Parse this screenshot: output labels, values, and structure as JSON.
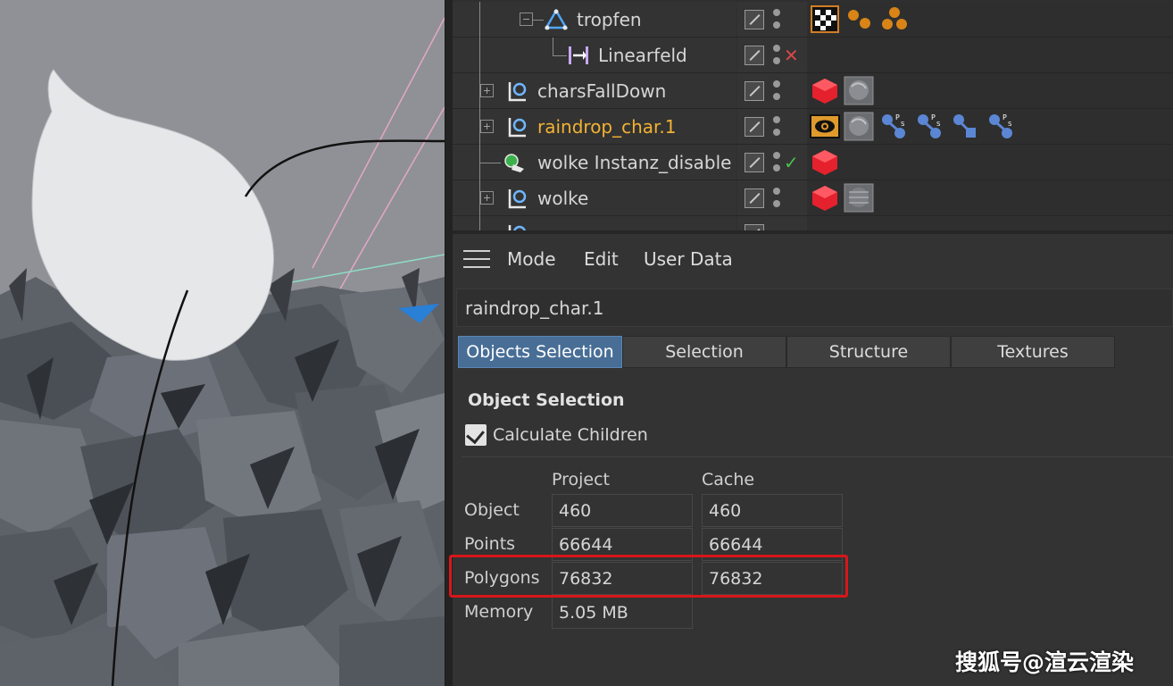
{
  "object_manager": {
    "rows": [
      {
        "label": "tropfen",
        "active": false,
        "icon": "null-emitter-icon",
        "state": "none",
        "tags": [
          "checker-material-tag",
          "orange-dots-tag",
          "orange-triangle-dots-tag"
        ]
      },
      {
        "label": "Linearfeld",
        "active": false,
        "icon": "linear-field-icon",
        "state": "disabled-x",
        "tags": []
      },
      {
        "label": "charsFallDown",
        "active": false,
        "icon": "connect-object-icon",
        "state": "none",
        "tags": [
          "red-cube-tag",
          "material-texture-tag"
        ]
      },
      {
        "label": "raindrop_char.1",
        "active": true,
        "icon": "connect-object-icon",
        "state": "none",
        "tags": [
          "display-eye-tag",
          "material-texture-tag",
          "psr-constraint-tag",
          "psr-constraint-tag",
          "ik-tag",
          "psr-constraint-tag"
        ]
      },
      {
        "label": "wolke Instanz_disable",
        "active": false,
        "icon": "instance-object-icon",
        "state": "enabled-check",
        "tags": [
          "red-cube-tag"
        ]
      },
      {
        "label": "wolke",
        "active": false,
        "icon": "connect-object-icon",
        "state": "none",
        "tags": [
          "red-cube-tag",
          "material-texture-tag"
        ]
      }
    ]
  },
  "attribute_manager": {
    "menu": [
      "Mode",
      "Edit",
      "User Data"
    ],
    "object_name": "raindrop_char.1",
    "tabs": [
      {
        "label": "Objects Selection",
        "active": true
      },
      {
        "label": "Selection",
        "active": false
      },
      {
        "label": "Structure",
        "active": false
      },
      {
        "label": "Textures",
        "active": false
      }
    ],
    "section_title": "Object Selection",
    "calculate_children": {
      "label": "Calculate Children",
      "checked": true
    },
    "columns": [
      "Project",
      "Cache"
    ],
    "stats": [
      {
        "label": "Object",
        "project": "460",
        "cache": "460"
      },
      {
        "label": "Points",
        "project": "66644",
        "cache": "66644"
      },
      {
        "label": "Polygons",
        "project": "76832",
        "cache": "76832"
      },
      {
        "label": "Memory",
        "project": "5.05 MB",
        "cache": ""
      }
    ],
    "highlight_color": "#d8161a"
  },
  "watermark": "搜狐号@渲云渲染"
}
